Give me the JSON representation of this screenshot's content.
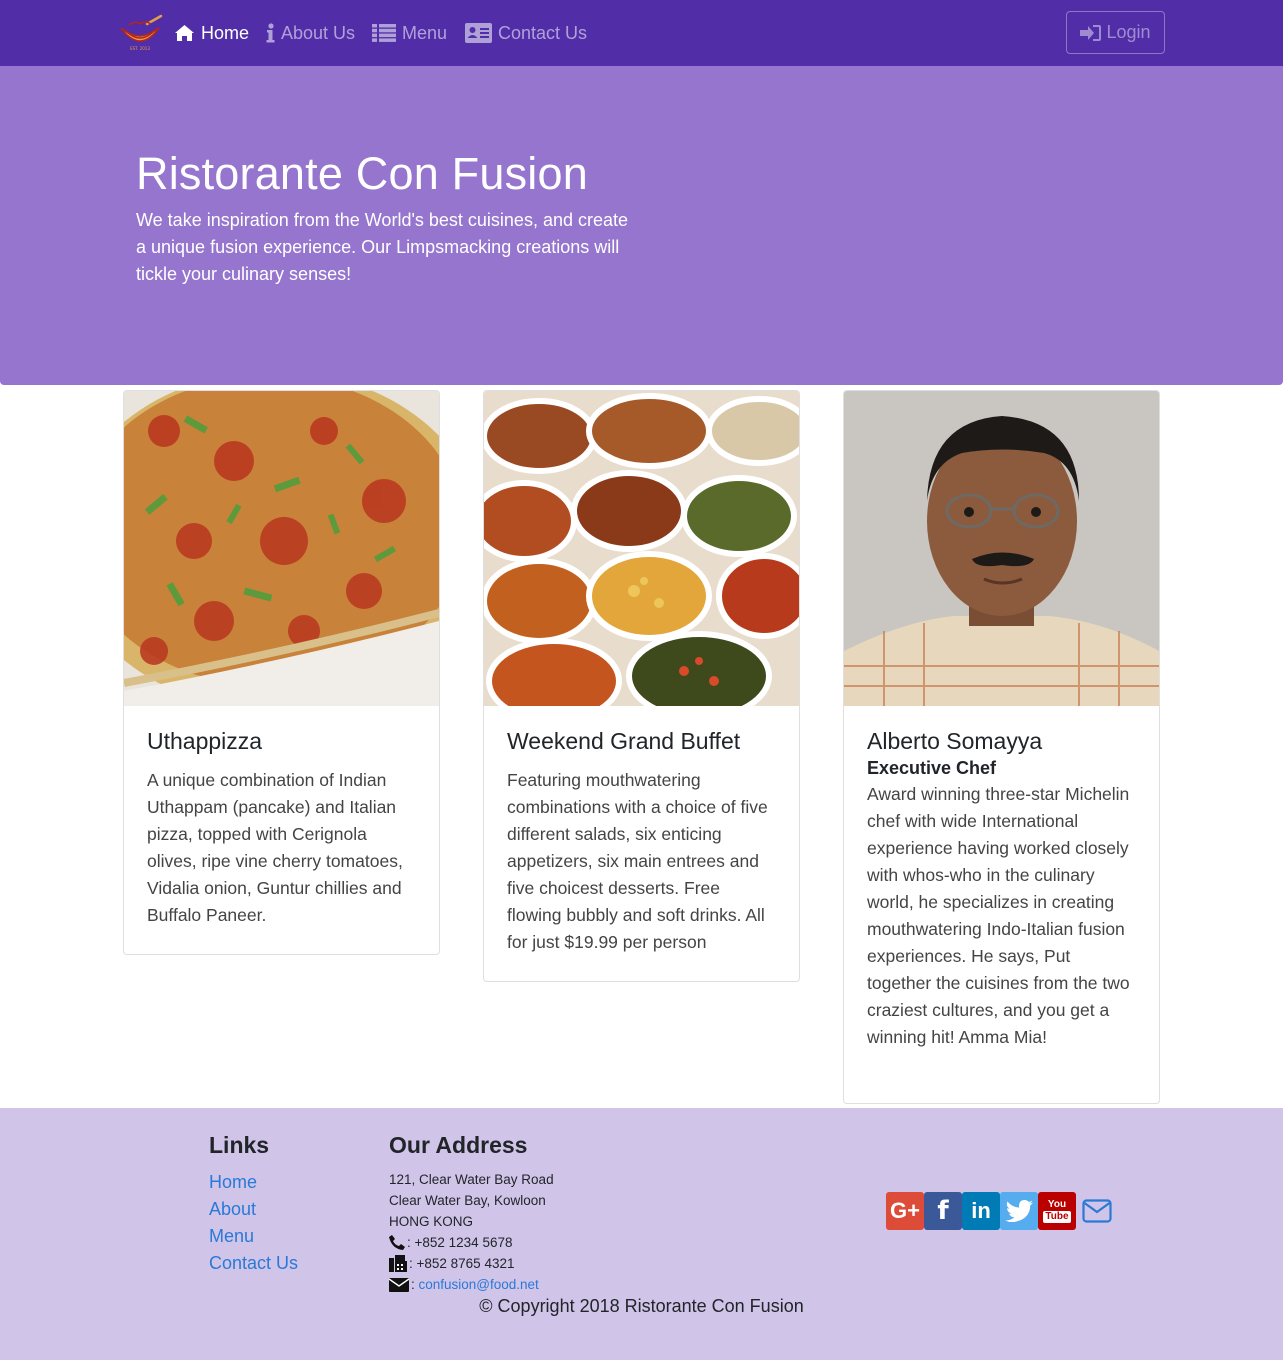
{
  "navbar": {
    "brand_logo_text": "Ristorante Con Fusion",
    "items": [
      {
        "label": "Home",
        "icon": "home-icon",
        "active": true
      },
      {
        "label": "About Us",
        "icon": "info-icon",
        "active": false
      },
      {
        "label": "Menu",
        "icon": "list-icon",
        "active": false
      },
      {
        "label": "Contact Us",
        "icon": "address-card-icon",
        "active": false
      }
    ],
    "login_label": "Login"
  },
  "jumbotron": {
    "title": "Ristorante Con Fusion",
    "text": "We take inspiration from the World's best cuisines, and create a unique fusion experience. Our Limpsmacking creations will tickle your culinary senses!"
  },
  "cards": [
    {
      "title": "Uthappizza",
      "subtitle": "",
      "text": "A unique combination of Indian Uthappam (pancake) and Italian pizza, topped with Cerignola olives, ripe vine cherry tomatoes, Vidalia onion, Guntur chillies and Buffalo Paneer."
    },
    {
      "title": "Weekend Grand Buffet",
      "subtitle": "",
      "text": "Featuring mouthwatering combinations with a choice of five different salads, six enticing appetizers, six main entrees and five choicest desserts. Free flowing bubbly and soft drinks. All for just $19.99 per person"
    },
    {
      "title": "Alberto Somayya",
      "subtitle": "Executive Chef",
      "text": "Award winning three-star Michelin chef with wide International experience having worked closely with whos-who in the culinary world, he specializes in creating mouthwatering Indo-Italian fusion experiences. He says, Put together the cuisines from the two craziest cultures, and you get a winning hit! Amma Mia!"
    }
  ],
  "footer": {
    "links_title": "Links",
    "links": [
      "Home",
      "About",
      "Menu",
      "Contact Us"
    ],
    "address_title": "Our Address",
    "address_lines": [
      "121, Clear Water Bay Road",
      "Clear Water Bay, Kowloon",
      "HONG KONG"
    ],
    "phone": ": +852 1234 5678",
    "fax": ": +852 8765 4321",
    "email_prefix": ": ",
    "email": "confusion@food.net",
    "social": [
      "google-plus-icon",
      "facebook-icon",
      "linkedin-icon",
      "twitter-icon",
      "youtube-icon",
      "envelope-icon"
    ],
    "social_labels": {
      "google": "G+",
      "facebook": "f",
      "linkedin": "in",
      "youtube_top": "You",
      "youtube_bottom": "Tube"
    },
    "copyright": "© Copyright 2018 Ristorante Con Fusion"
  },
  "colors": {
    "primary": "#512DA8",
    "light": "#9575CD",
    "footer": "#D1C4E9",
    "link": "#2979d7"
  }
}
